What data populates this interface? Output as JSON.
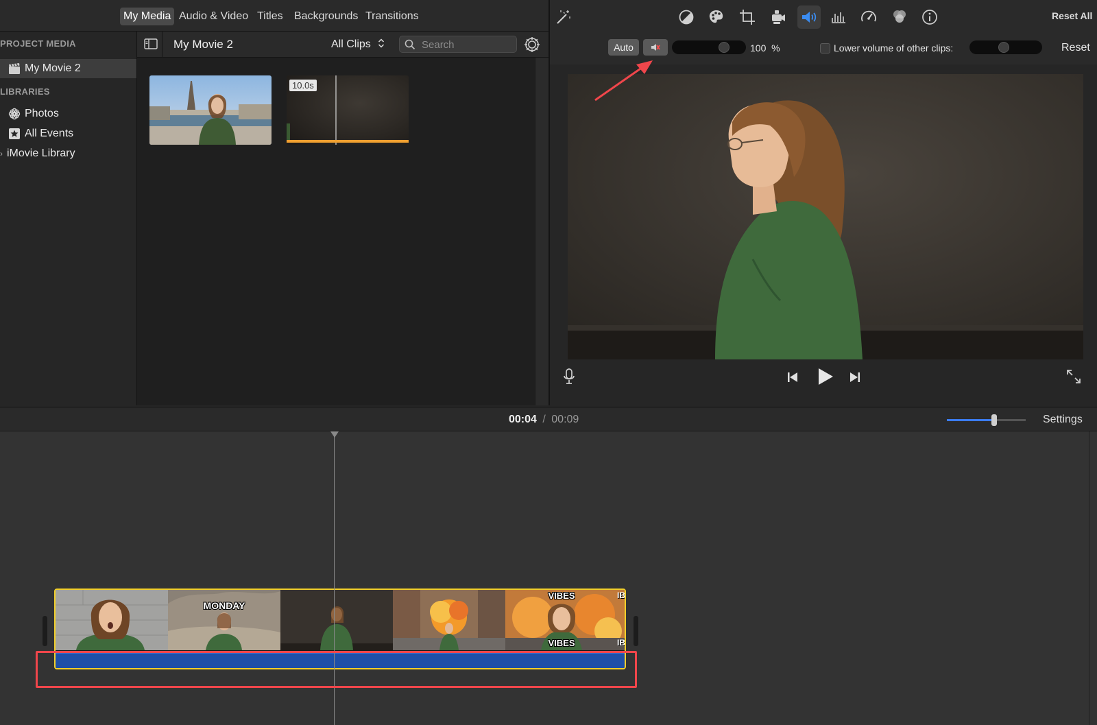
{
  "tabs": [
    "My Media",
    "Audio & Video",
    "Titles",
    "Backgrounds",
    "Transitions"
  ],
  "sidebar": {
    "project_media_heading": "PROJECT MEDIA",
    "project_item": "My Movie 2",
    "libraries_heading": "LIBRARIES",
    "photos": "Photos",
    "all_events": "All Events",
    "imovie_library": "iMovie Library"
  },
  "browser": {
    "title": "My Movie 2",
    "filter": "All Clips",
    "search_placeholder": "Search",
    "clip2_duration": "10.0s"
  },
  "viewer": {
    "reset_all": "Reset All",
    "auto": "Auto",
    "volume_value": "100",
    "volume_unit": "%",
    "lower_volume_label": "Lower volume of other clips:",
    "reset": "Reset",
    "volume_level": 0.75
  },
  "timeline": {
    "current_time": "00:04",
    "separator": "/",
    "total_time": "00:09",
    "settings": "Settings",
    "zoom_level": 0.6,
    "caption_monday": "MONDAY",
    "caption_vibes_top": "VIBES",
    "caption_vibes_bottom": "VIBES",
    "caption_ib_top": "IB",
    "caption_ib_bottom": "IB"
  },
  "colors": {
    "accent_blue": "#3b7cf0",
    "clip_border_yellow": "#f2cf2a",
    "annotation_red": "#f0464b",
    "audio_bar_blue": "#1e4fa8"
  }
}
